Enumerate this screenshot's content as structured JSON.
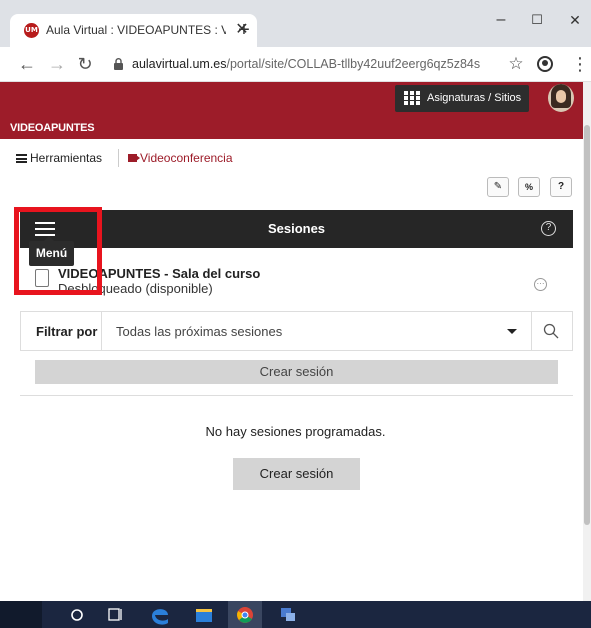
{
  "browser": {
    "tab_title": "Aula Virtual : VIDEOAPUNTES : Vi",
    "favicon_text": "UM",
    "url_host": "aulavirtual.um.es",
    "url_path": "/portal/site/COLLAB-tllby42uuf2eerg6qz5z84s",
    "window_controls": {
      "minimize": "–",
      "maximize": "☐",
      "close": "✕"
    }
  },
  "site": {
    "brand_color": "#9d1c29",
    "sites_button": "Asignaturas / Sitios",
    "title": "VIDEOAPUNTES"
  },
  "tools": {
    "herramientas": "Herramientas",
    "videoconferencia": "Videoconferencia"
  },
  "sessions": {
    "bar_title": "Sesiones",
    "menu_tooltip": "Menú",
    "room_name": "VIDEOAPUNTES - Sala del curso",
    "room_status": "Desbloqueado (disponible)",
    "filter_label": "Filtrar por",
    "filter_value": "Todas las próximas sesiones",
    "create_top": "Crear sesión",
    "empty_message": "No hay sesiones programadas.",
    "create_button": "Crear sesión"
  },
  "highlight_color": "#e8141e"
}
